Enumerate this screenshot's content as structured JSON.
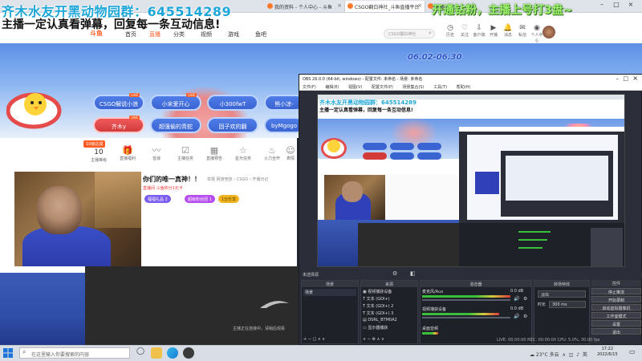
{
  "browser": {
    "tabs": [
      {
        "label": "我的资料 - 个人中心 - 斗鱼",
        "active": false
      },
      {
        "label": "CSGO翻白神社_斗鱼直播平台",
        "active": true
      },
      {
        "label": "主播一",
        "active": false
      }
    ]
  },
  "overlay": {
    "top_left": "齐木水友开黑动物园群：645514289",
    "subtitle": "主播一定认真看弹幕，回复每一条互动信息!",
    "top_right": "开通钻粉，主播上号打3盘~"
  },
  "header": {
    "logo": "斗鱼",
    "nav": [
      "首页",
      "直播",
      "分类",
      "视频",
      "游戏",
      "鱼吧"
    ],
    "active_nav": "直播",
    "search_placeholder": "CSGO翻白神社",
    "icons": [
      {
        "name": "history-icon",
        "label": "历史"
      },
      {
        "name": "follow-icon",
        "label": "关注"
      },
      {
        "name": "download-icon",
        "label": "客户端"
      },
      {
        "name": "live-icon",
        "label": "开播"
      },
      {
        "name": "notify-icon",
        "label": "消息"
      },
      {
        "name": "message-icon",
        "label": "私信"
      },
      {
        "name": "shop-icon",
        "label": "个人中心"
      }
    ]
  },
  "banner": {
    "daterange": "06.02-06.30",
    "chips": [
      {
        "label": "CSGO解说小浪",
        "color": "blue",
        "live": true
      },
      {
        "label": "小宋爱开心",
        "color": "blue",
        "live": true
      },
      {
        "label": "小300fwT",
        "color": "blue",
        "live": false
      },
      {
        "label": "熊小凉-",
        "color": "blue",
        "live": false
      },
      {
        "label": "齐木y",
        "color": "red",
        "live": true
      },
      {
        "label": "超强偷的青蛇",
        "color": "blue",
        "live": false
      },
      {
        "label": "固子欢的翻",
        "color": "blue",
        "live": false
      },
      {
        "label": "byMgogo",
        "color": "blue",
        "live": false
      }
    ]
  },
  "stats": [
    {
      "value": "10",
      "label": "主播等级"
    },
    {
      "label": "直播福利",
      "badge": ""
    },
    {
      "label": "音浪"
    },
    {
      "label": "主播任务"
    },
    {
      "label": "直播预告"
    },
    {
      "label": "星光任务"
    },
    {
      "label": "火力全开"
    },
    {
      "label": "表情"
    }
  ],
  "level_tag": "10级达成",
  "room": {
    "title": "你们的唯一真神！！",
    "meta": "举报  网游竞技 › CSGO › 开播日记",
    "info": "直播间 斗鱼积分1元卡",
    "tags": [
      {
        "label": "福福礼品 2",
        "color": "#7a5cf0"
      },
      {
        "label": "超级粉丝团 1",
        "color": "#b44cf0"
      },
      {
        "label": "1分乐享",
        "color": "#f0b41e"
      }
    ]
  },
  "darkpane": {
    "note": "主播正在连接中，请稍后观看"
  },
  "obs": {
    "title": "OBS 26.0.0 (64-bit, windows) - 配置文件: 未命名 - 场景: 未命名",
    "menu": [
      "文件(F)",
      "编辑(E)",
      "视图(V)",
      "配置文件(P)",
      "场景集合(S)",
      "工具(T)",
      "帮助(H)"
    ],
    "toolbar_label": "未选择源",
    "docks": {
      "scenes": {
        "title": "场景",
        "items": [
          "场景"
        ]
      },
      "sources": {
        "title": "来源",
        "items": [
          "视频捕获设备",
          "文本 (GDI+)",
          "文本 (GDI+) 2",
          "文本 (GDI+) 3",
          "DSRL_BTM0A2",
          "显示器捕获"
        ]
      },
      "mixer": {
        "title": "混音器",
        "channels": [
          {
            "name": "麦克风/Aux",
            "db": "0.0 dB"
          },
          {
            "name": "视频捕获设备",
            "db": "0.0 dB"
          },
          {
            "name": "桌面音频",
            "db": ""
          }
        ]
      },
      "transitions": {
        "title": "转场特效",
        "type": "淡出",
        "duration_label": "时长",
        "duration": "300 ms"
      },
      "controls": {
        "title": "控件",
        "buttons": [
          "停止推流",
          "开始录制",
          "启动虚拟摄像机",
          "工作室模式",
          "设置",
          "退出"
        ]
      }
    },
    "status": "LIVE: 00:00:00  REC: 00:00:00  CPU: 5.0%, 30.00 fps"
  },
  "taskbar": {
    "search_placeholder": "在这里输入你要搜索的内容",
    "weather": "23°C 多云",
    "time": "17:22",
    "date": "2022/6/15",
    "ime": "英"
  },
  "colors": {
    "accent": "#ff5d23",
    "overlay_blue": "#1ea6d8",
    "overlay_green": "#9df06a",
    "chip_blue": "#3a64d2",
    "chip_red": "#d33b3b"
  }
}
